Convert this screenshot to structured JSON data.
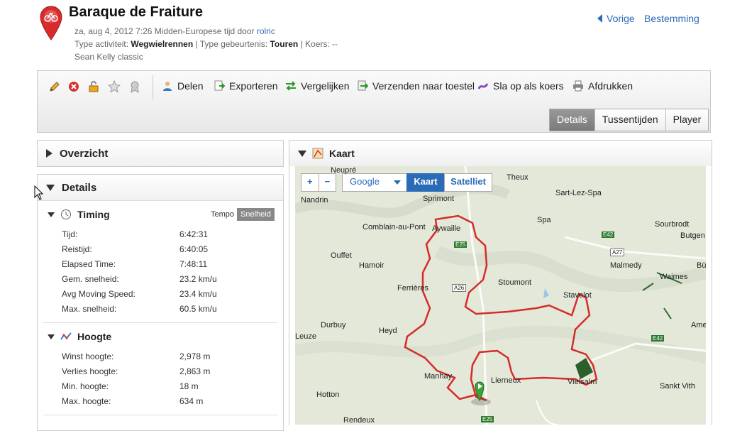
{
  "header": {
    "title": "Baraque de Fraiture",
    "meta_line1_prefix": "za, aug 4, 2012 7:26 Midden-Europese tijd door ",
    "author": "rolric",
    "type_label": "Type activiteit: ",
    "type_value": "Wegwielrennen",
    "event_label": " | Type gebeurtenis: ",
    "event_value": "Touren",
    "course_label": " | Koers: --",
    "description": "Sean Kelly classic",
    "nav_prev": "Vorige",
    "nav_next": "Bestemming"
  },
  "toolbar": {
    "actions": [
      "Delen",
      "Exporteren",
      "Vergelijken",
      "Verzenden naar toestel",
      "Sla op als koers",
      "Afdrukken"
    ],
    "icons": [
      "pencil-icon",
      "delete-icon",
      "lock-icon",
      "star-icon",
      "badge-icon"
    ],
    "tabs": [
      "Details",
      "Tussentijden",
      "Player"
    ],
    "active_tab": "Details"
  },
  "panels": {
    "overview_title": "Overzicht",
    "details_title": "Details",
    "timing": {
      "title": "Timing",
      "toggle_tempo": "Tempo",
      "toggle_speed": "Snelheid",
      "rows": [
        {
          "k": "Tijd:",
          "v": "6:42:31"
        },
        {
          "k": "Reistijd:",
          "v": "6:40:05"
        },
        {
          "k": "Elapsed Time:",
          "v": "7:48:11"
        },
        {
          "k": "Gem. snelheid:",
          "v": "23.2 km/u"
        },
        {
          "k": "Avg Moving Speed:",
          "v": "23.4 km/u"
        },
        {
          "k": "Max. snelheid:",
          "v": "60.5 km/u"
        }
      ]
    },
    "height": {
      "title": "Hoogte",
      "rows": [
        {
          "k": "Winst hoogte:",
          "v": "2,978 m"
        },
        {
          "k": "Verlies hoogte:",
          "v": "2,863 m"
        },
        {
          "k": "Min. hoogte:",
          "v": "18 m"
        },
        {
          "k": "Max. hoogte:",
          "v": "634 m"
        }
      ]
    }
  },
  "map": {
    "title": "Kaart",
    "provider": "Google",
    "btn_map": "Kaart",
    "btn_sat": "Satelliet",
    "zoom_in": "+",
    "zoom_out": "−",
    "cities": [
      "Neupré",
      "Theux",
      "Sart-Lez-Spa",
      "Nandrin",
      "Sprimont",
      "Spa",
      "Sourbrodt",
      "Butgen",
      "Comblain-au-Pont",
      "Aywaille",
      "Ouffet",
      "Hamoir",
      "Malmedy",
      "Waimes",
      "Ferrières",
      "Stoumont",
      "Stavelot",
      "Durbuy",
      "Heyd",
      "Manhay",
      "Lierneux",
      "Vielsalm",
      "Sankt Vith",
      "Hotton",
      "Rendeux",
      "Leuze",
      "Ame",
      "Bü"
    ],
    "roads": [
      "E25",
      "A26",
      "E42",
      "A27",
      "E42",
      "E25"
    ]
  }
}
